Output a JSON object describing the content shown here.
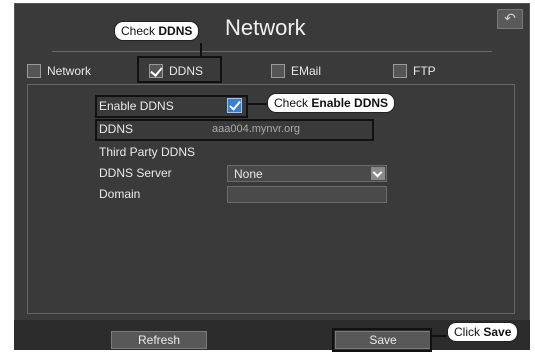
{
  "window": {
    "title": "Network",
    "back_icon": "back-arrow-icon"
  },
  "tabs": [
    {
      "label": "Network",
      "checked": false
    },
    {
      "label": "DDNS",
      "checked": true
    },
    {
      "label": "EMail",
      "checked": false
    },
    {
      "label": "FTP",
      "checked": false
    }
  ],
  "form": {
    "enable_ddns_label": "Enable DDNS",
    "enable_ddns_checked": true,
    "ddns_label": "DDNS",
    "ddns_value": "aaa004.mynvr.org",
    "third_party_label": "Third Party DDNS",
    "ddns_server_label": "DDNS Server",
    "ddns_server_value": "None",
    "domain_label": "Domain",
    "domain_value": ""
  },
  "footer": {
    "refresh_label": "Refresh",
    "save_label": "Save"
  },
  "callouts": {
    "ddns_prefix": "Check ",
    "ddns_bold": "DDNS",
    "enable_prefix": "Check ",
    "enable_bold": "Enable DDNS",
    "save_prefix": "Click ",
    "save_bold": "Save"
  },
  "colors": {
    "window_bg": "#3a3a3a",
    "footer_bg": "#2c2c2c",
    "checkbox_accent": "#3c7ed1"
  }
}
